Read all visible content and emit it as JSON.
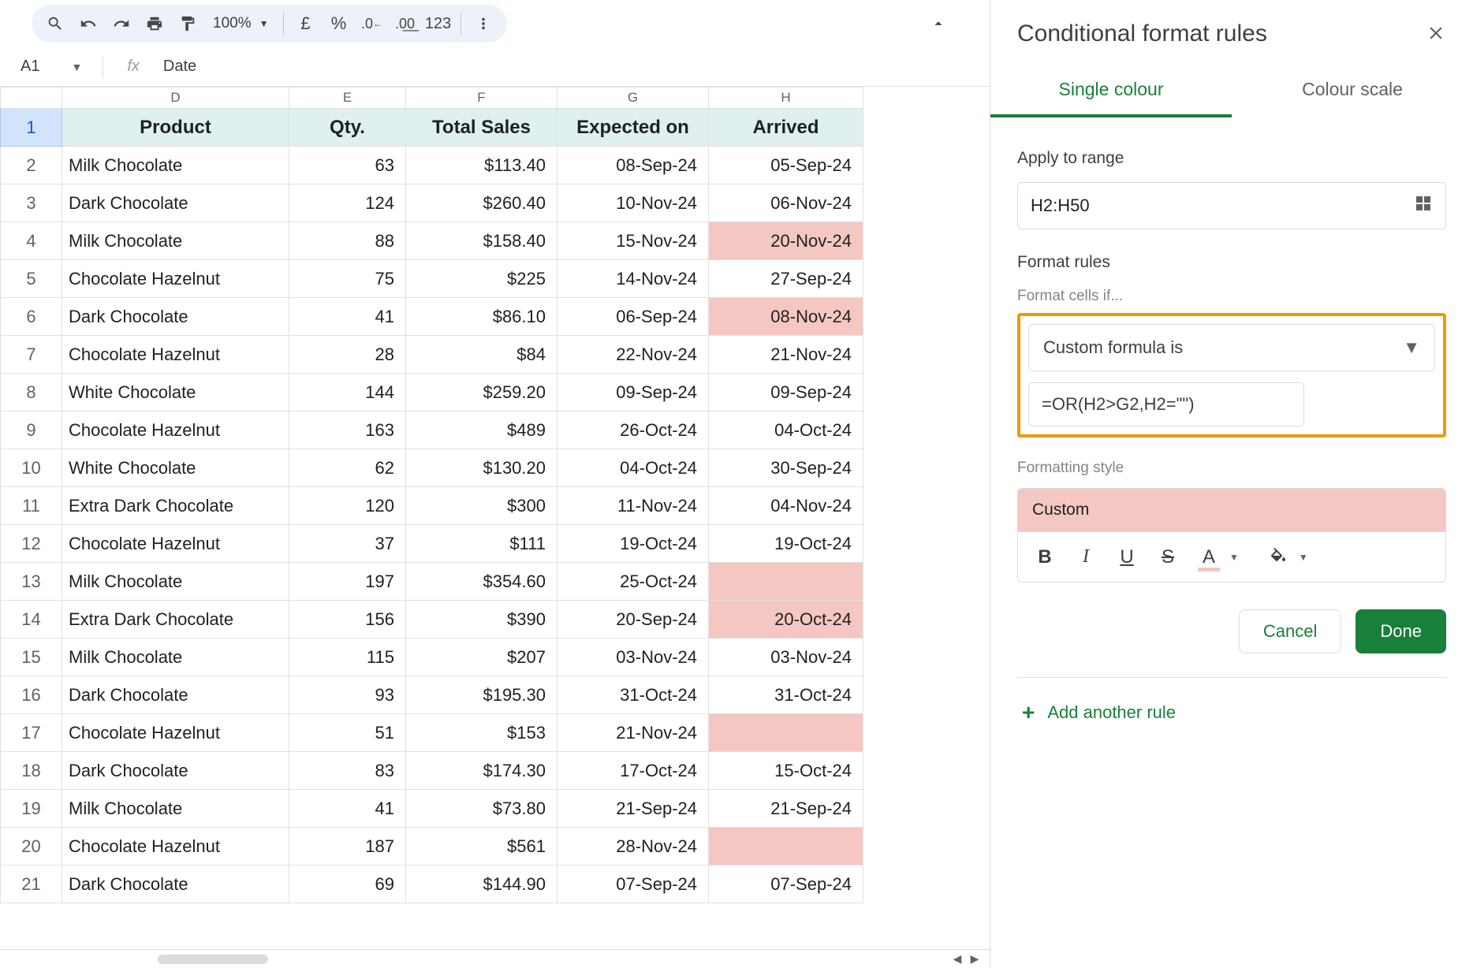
{
  "toolbar": {
    "zoom": "100%",
    "currency_symbol": "£",
    "percent_symbol": "%",
    "number_sample": "123"
  },
  "namebox": {
    "cell": "A1",
    "fx_label": "fx",
    "value": "Date"
  },
  "columns": [
    "D",
    "E",
    "F",
    "G",
    "H"
  ],
  "headers": [
    "Product",
    "Qty.",
    "Total Sales",
    "Expected on",
    "Arrived"
  ],
  "rows": [
    {
      "n": 2,
      "p": "Milk Chocolate",
      "q": "63",
      "s": "$113.40",
      "e": "08-Sep-24",
      "a": "05-Sep-24",
      "hl": false
    },
    {
      "n": 3,
      "p": "Dark Chocolate",
      "q": "124",
      "s": "$260.40",
      "e": "10-Nov-24",
      "a": "06-Nov-24",
      "hl": false
    },
    {
      "n": 4,
      "p": "Milk Chocolate",
      "q": "88",
      "s": "$158.40",
      "e": "15-Nov-24",
      "a": "20-Nov-24",
      "hl": true
    },
    {
      "n": 5,
      "p": "Chocolate Hazelnut",
      "q": "75",
      "s": "$225",
      "e": "14-Nov-24",
      "a": "27-Sep-24",
      "hl": false
    },
    {
      "n": 6,
      "p": "Dark Chocolate",
      "q": "41",
      "s": "$86.10",
      "e": "06-Sep-24",
      "a": "08-Nov-24",
      "hl": true
    },
    {
      "n": 7,
      "p": "Chocolate Hazelnut",
      "q": "28",
      "s": "$84",
      "e": "22-Nov-24",
      "a": "21-Nov-24",
      "hl": false
    },
    {
      "n": 8,
      "p": "White Chocolate",
      "q": "144",
      "s": "$259.20",
      "e": "09-Sep-24",
      "a": "09-Sep-24",
      "hl": false
    },
    {
      "n": 9,
      "p": "Chocolate Hazelnut",
      "q": "163",
      "s": "$489",
      "e": "26-Oct-24",
      "a": "04-Oct-24",
      "hl": false
    },
    {
      "n": 10,
      "p": "White Chocolate",
      "q": "62",
      "s": "$130.20",
      "e": "04-Oct-24",
      "a": "30-Sep-24",
      "hl": false
    },
    {
      "n": 11,
      "p": "Extra Dark Chocolate",
      "q": "120",
      "s": "$300",
      "e": "11-Nov-24",
      "a": "04-Nov-24",
      "hl": false
    },
    {
      "n": 12,
      "p": "Chocolate Hazelnut",
      "q": "37",
      "s": "$111",
      "e": "19-Oct-24",
      "a": "19-Oct-24",
      "hl": false
    },
    {
      "n": 13,
      "p": "Milk Chocolate",
      "q": "197",
      "s": "$354.60",
      "e": "25-Oct-24",
      "a": "",
      "hl": true
    },
    {
      "n": 14,
      "p": "Extra Dark Chocolate",
      "q": "156",
      "s": "$390",
      "e": "20-Sep-24",
      "a": "20-Oct-24",
      "hl": true
    },
    {
      "n": 15,
      "p": "Milk Chocolate",
      "q": "115",
      "s": "$207",
      "e": "03-Nov-24",
      "a": "03-Nov-24",
      "hl": false
    },
    {
      "n": 16,
      "p": "Dark Chocolate",
      "q": "93",
      "s": "$195.30",
      "e": "31-Oct-24",
      "a": "31-Oct-24",
      "hl": false
    },
    {
      "n": 17,
      "p": "Chocolate Hazelnut",
      "q": "51",
      "s": "$153",
      "e": "21-Nov-24",
      "a": "",
      "hl": true
    },
    {
      "n": 18,
      "p": "Dark Chocolate",
      "q": "83",
      "s": "$174.30",
      "e": "17-Oct-24",
      "a": "15-Oct-24",
      "hl": false
    },
    {
      "n": 19,
      "p": "Milk Chocolate",
      "q": "41",
      "s": "$73.80",
      "e": "21-Sep-24",
      "a": "21-Sep-24",
      "hl": false
    },
    {
      "n": 20,
      "p": "Chocolate Hazelnut",
      "q": "187",
      "s": "$561",
      "e": "28-Nov-24",
      "a": "",
      "hl": true
    },
    {
      "n": 21,
      "p": "Dark Chocolate",
      "q": "69",
      "s": "$144.90",
      "e": "07-Sep-24",
      "a": "07-Sep-24",
      "hl": false
    }
  ],
  "sidebar": {
    "title": "Conditional format rules",
    "tab_single": "Single colour",
    "tab_scale": "Colour scale",
    "apply_label": "Apply to range",
    "range": "H2:H50",
    "rules_label": "Format rules",
    "cells_if": "Format cells if...",
    "condition": "Custom formula is",
    "formula": "=OR(H2>G2,H2=\"\")",
    "style_label": "Formatting style",
    "style_name": "Custom",
    "cancel": "Cancel",
    "done": "Done",
    "add_rule": "Add another rule"
  }
}
